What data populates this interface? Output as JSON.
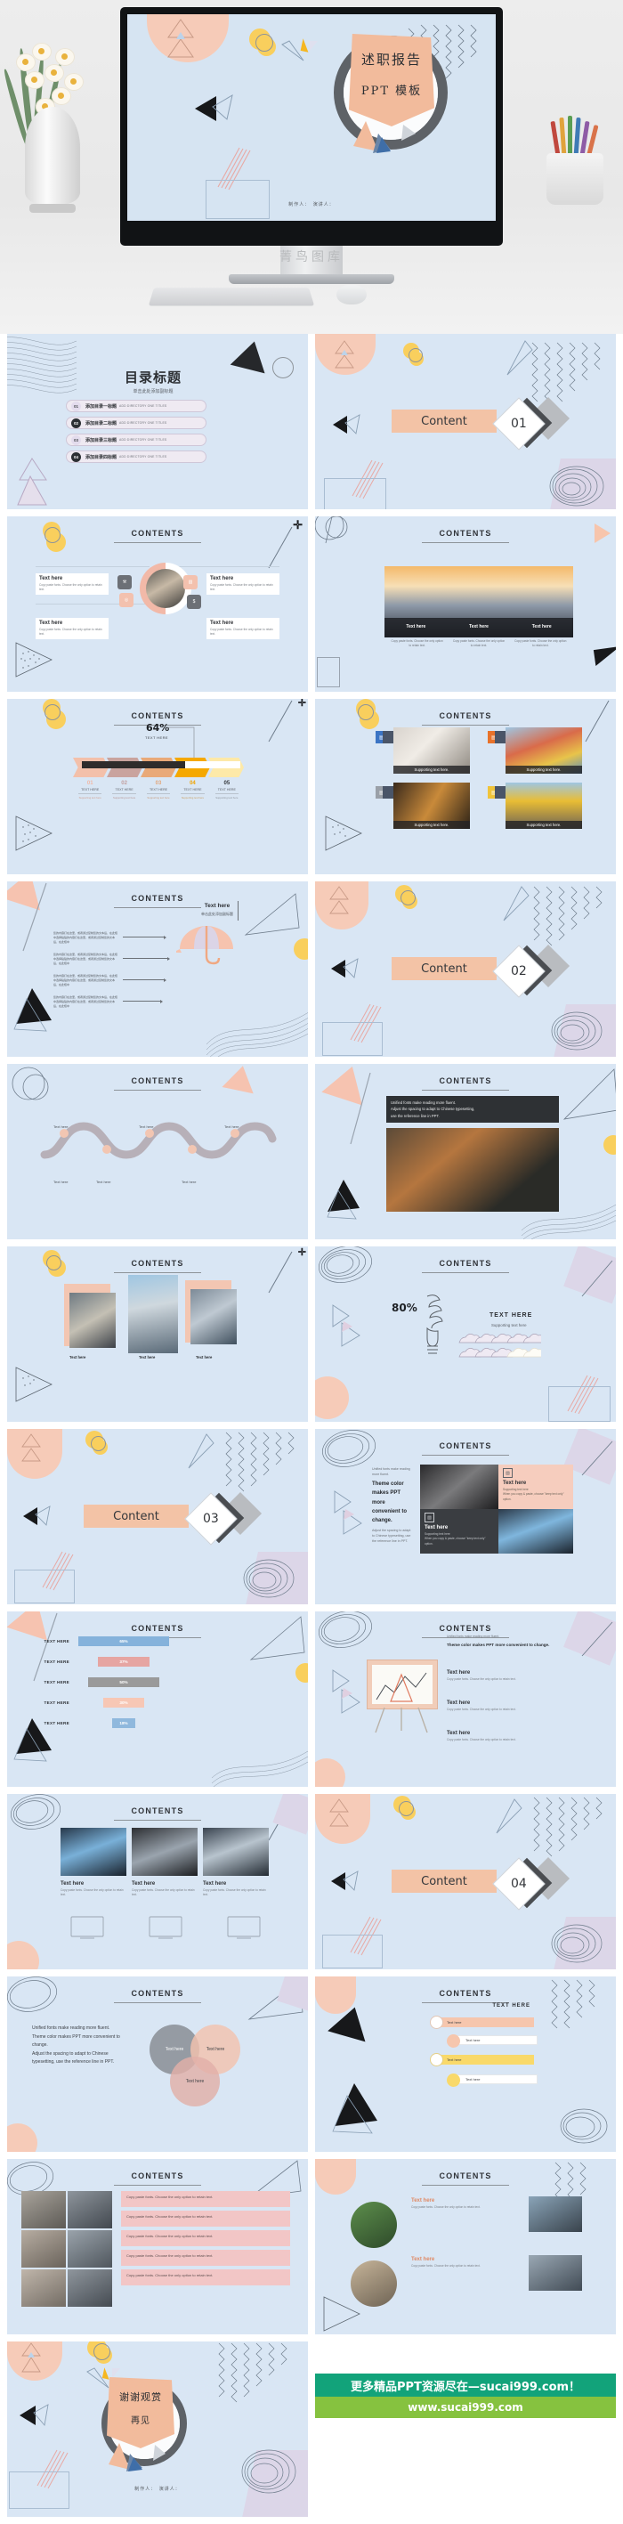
{
  "hero": {
    "title_cn": "述职报告",
    "title_en": "PPT 模板",
    "byline": "制作人：　演讲人：",
    "watermark": "菁鸟图库"
  },
  "toc": {
    "title": "目录标题",
    "subtitle": "单击此处添加副标题",
    "rows": [
      {
        "num": "01",
        "cn": "添加目录一标题",
        "en": "ADD DIRECTORY ONE TITLES"
      },
      {
        "num": "02",
        "cn": "添加目录二标题",
        "en": "ADD DIRECTORY ONE TITLES"
      },
      {
        "num": "03",
        "cn": "添加目录三标题",
        "en": "ADD DIRECTORY ONE TITLES"
      },
      {
        "num": "04",
        "cn": "添加目录四标题",
        "en": "ADD DIRECTORY ONE TITLES"
      }
    ]
  },
  "section_label": "Content",
  "sections": [
    {
      "num": "01"
    },
    {
      "num": "02"
    },
    {
      "num": "03"
    },
    {
      "num": "04"
    }
  ],
  "contents_header": "CONTENTS",
  "common": {
    "text_here": "Text here",
    "text_here_caps": "TEXT HERE",
    "supporting": "Supporting text here",
    "supporting_dot": "Supporting text here.",
    "body": "Copy paste fonts. Choose the only option to retain text.",
    "body2": "When you copy & paste, choose \"keep text only\" option.",
    "cn_sub": "单击此处添加副标题",
    "cn_body": "您的内容打在这里，或者通过复制您的文本后，在此框中选择粘贴的内容打在这里，或者通过复制您的文本后，在此框中",
    "unified": "Unified fonts make reading more fluent.",
    "adjust": "Adjust the spacing to adapt to Chinese typesetting,",
    "reference": " use the reference line in PPT.",
    "theme": "Theme color makes PPT more convenient to change.",
    "adjust2": "Adjust the spacing to adapt to Chinese typesetting, use the reference line in PPT."
  },
  "funnel": {
    "pct": "64%",
    "pct_label": "TEXT HERE",
    "steps": [
      "01",
      "02",
      "03",
      "04",
      "05"
    ],
    "step_label": "TEXT HERE",
    "step_sub": "Supporting text here"
  },
  "bulb": {
    "pct": "80%",
    "title": "TEXT HERE",
    "sub": "Supporting text here"
  },
  "chart_data": {
    "type": "bar",
    "title": "CONTENTS",
    "orientation": "horizontal",
    "categories": [
      "TEXT HERE",
      "TEXT HERE",
      "TEXT HERE",
      "TEXT HERE",
      "TEXT HERE"
    ],
    "values": [
      65,
      37,
      50,
      30,
      18
    ],
    "value_labels": [
      "65%",
      "37%",
      "50%",
      "30%",
      "18%"
    ],
    "colors": [
      "#85b2db",
      "#e6a5a2",
      "#9a9a9a",
      "#f7c7b5",
      "#8fb8dd"
    ],
    "xlabel": "",
    "ylabel": "",
    "xlim": [
      0,
      100
    ],
    "grid": false,
    "legend": false
  },
  "final": {
    "thanks_main": "谢谢观赏",
    "thanks_sub": "再见",
    "byline": "制作人：　演讲人："
  },
  "footer": {
    "line1": "更多精品PPT资源尽在—sucai999.com！",
    "line2": "www.sucai999.com"
  },
  "colors": {
    "slide_bg": "#d9e6f4",
    "peach": "#f6cbb8",
    "accent_bar": "#f3c3a6",
    "yellow": "#f9cf5d",
    "lilac": "#dcd6e8",
    "dark": "#2e3134",
    "green": "#12a37a",
    "lightgreen": "#86c23f"
  }
}
